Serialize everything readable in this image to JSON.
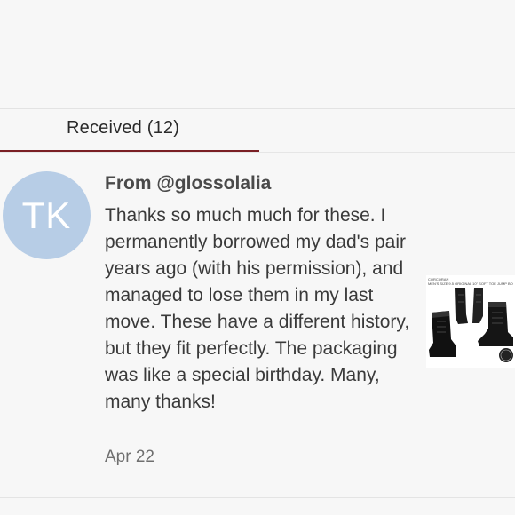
{
  "tabs": {
    "received_label": "Received (12)"
  },
  "review": {
    "avatar_initials": "TK",
    "from": "From @glossolalia",
    "text": "Thanks so much much for these. I permanently borrowed my dad's pair years ago (with his permission), and managed to lose them in my last move. These have a different history, but they fit perfectly. The packaging was like a special birthday. Many, many thanks!",
    "date": "Apr 22",
    "product_image": {
      "caption_line1": "CORCORAN",
      "caption_line2": "MEN'S SIZE 9.5 ORIGINAL 10\" SOFT TOE JUMP BOOT #1500"
    }
  },
  "colors": {
    "tab_underline": "#7a1f24",
    "avatar_bg": "#b7cde6",
    "background": "#f7f7f7"
  },
  "icons": {
    "product": "boot-photo"
  }
}
